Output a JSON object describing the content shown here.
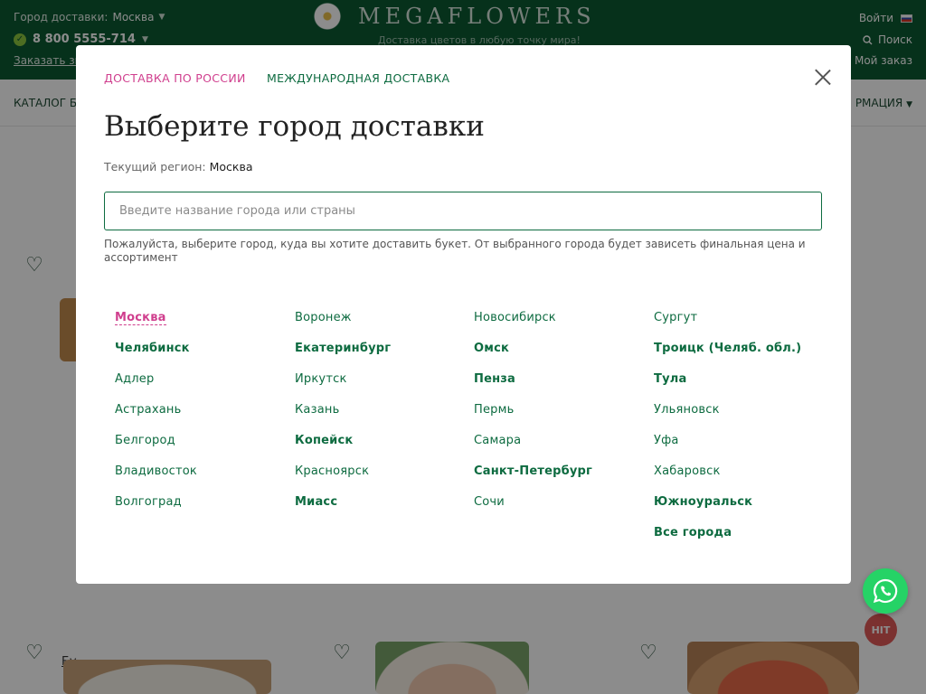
{
  "header": {
    "city_label": "Город доставки:",
    "city_value": "Москва",
    "phone": "8 800 5555-714",
    "order_call": "Заказать зв",
    "logo_text": "MEGAFLOWERS",
    "tagline": "Доставка цветов в любую точку мира!",
    "login": "Войти",
    "search": "Поиск",
    "my_order": "Мой заказ"
  },
  "nav": {
    "left_label": "КАТАЛОГ БУ",
    "right_label": "РМАЦИЯ"
  },
  "background": {
    "link_fragment": "Бу",
    "hit_badge": "HIT"
  },
  "modal": {
    "tab_russia": "ДОСТАВКА ПО РОССИИ",
    "tab_international": "МЕЖДУНАРОДНАЯ ДОСТАВКА",
    "title": "Выберите город доставки",
    "region_label": "Текущий регион:",
    "region_value": "Москва",
    "search_placeholder": "Введите название города или страны",
    "hint": "Пожалуйста, выберите город, куда вы хотите доставить букет. От выбранного города будет зависеть финальная цена и ассортимент",
    "columns": [
      [
        {
          "label": "Москва",
          "bold": true,
          "active": true
        },
        {
          "label": "Челябинск",
          "bold": true
        },
        {
          "label": "Адлер"
        },
        {
          "label": "Астрахань"
        },
        {
          "label": "Белгород"
        },
        {
          "label": "Владивосток"
        },
        {
          "label": "Волгоград"
        }
      ],
      [
        {
          "label": "Воронеж"
        },
        {
          "label": "Екатеринбург",
          "bold": true
        },
        {
          "label": "Иркутск"
        },
        {
          "label": "Казань"
        },
        {
          "label": "Копейск",
          "bold": true
        },
        {
          "label": "Красноярск"
        },
        {
          "label": "Миасс",
          "bold": true
        }
      ],
      [
        {
          "label": "Новосибирск"
        },
        {
          "label": "Омск",
          "bold": true
        },
        {
          "label": "Пенза",
          "bold": true
        },
        {
          "label": "Пермь"
        },
        {
          "label": "Самара"
        },
        {
          "label": "Санкт-Петербург",
          "bold": true
        },
        {
          "label": "Сочи"
        }
      ],
      [
        {
          "label": "Сургут"
        },
        {
          "label": "Троицк (Челяб. обл.)",
          "bold": true
        },
        {
          "label": "Тула",
          "bold": true
        },
        {
          "label": "Ульяновск"
        },
        {
          "label": "Уфа"
        },
        {
          "label": "Хабаровск"
        },
        {
          "label": "Южноуральск",
          "bold": true
        },
        {
          "label": "Все города",
          "bold": true
        }
      ]
    ]
  },
  "colors": {
    "brand_green": "#0b5a32",
    "link_green": "#0d6b40",
    "accent_pink": "#d03f8e",
    "whatsapp": "#25d366",
    "hit_red": "#e05a58"
  },
  "icons": [
    "check-icon",
    "chevron-down-icon",
    "daisy-logo-icon",
    "flag-ru-icon",
    "search-icon",
    "close-icon",
    "heart-icon",
    "whatsapp-icon"
  ]
}
